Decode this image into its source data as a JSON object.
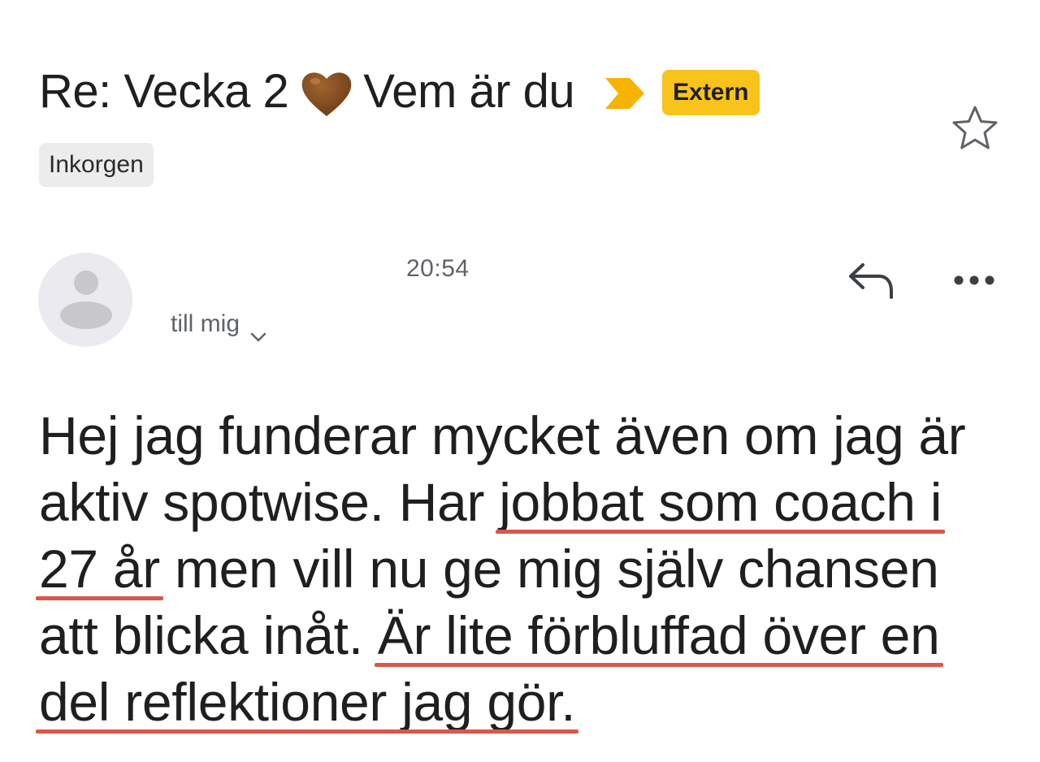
{
  "subject": {
    "prefix": "Re: Vecka 2",
    "heart_emoji": "brown-heart-icon",
    "suffix": "Vem är du",
    "importance_marker": "importance-arrow-icon",
    "badge_label": "Extern",
    "badge_color": "#f8c31a"
  },
  "labels": {
    "inbox_chip": "Inkorgen"
  },
  "star": "star-icon",
  "message": {
    "sender_name": "",
    "time": "20:54",
    "recipient_label": "till mig",
    "actions": [
      "reply-icon",
      "more-icon"
    ]
  },
  "body": {
    "line1": "Hej jag funderar mycket även om jag är",
    "line2_a": "aktiv spotwise. Har ",
    "line2_b": "jobbat som coach i",
    "line3_a": "27 år",
    "line3_b": " men vill nu ge mig själv chansen",
    "line4_a": "att blicka inåt. ",
    "line4_b": "Är lite förbluffad över en",
    "line5_a": "del reflektioner jag gör.",
    "underline_color": "#d9574a"
  }
}
